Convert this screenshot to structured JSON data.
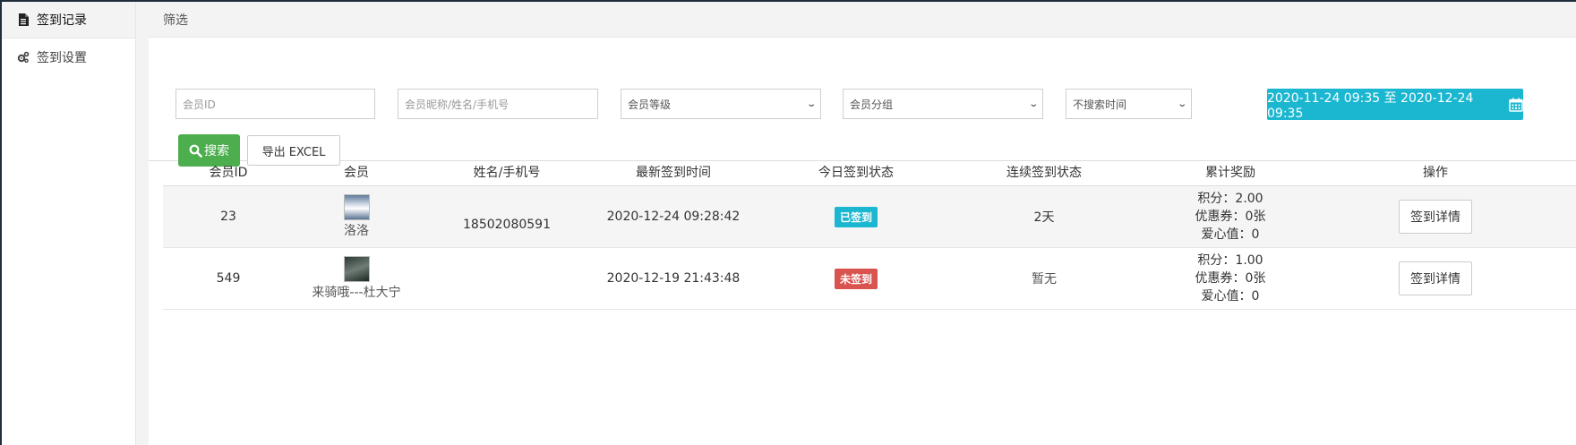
{
  "sidebar": {
    "items": [
      {
        "label": "签到记录",
        "icon": "file-icon",
        "active": true
      },
      {
        "label": "签到设置",
        "icon": "gears-icon",
        "active": false
      }
    ]
  },
  "header": {
    "title": "筛选"
  },
  "filters": {
    "member_id_placeholder": "会员ID",
    "name_placeholder": "会员昵称/姓名/手机号",
    "level_select": "会员等级",
    "group_select": "会员分组",
    "time_select": "不搜索时间",
    "date_range": "2020-11-24 09:35 至 2020-12-24 09:35",
    "search_label": "搜索",
    "export_label": "导出 EXCEL"
  },
  "table": {
    "columns": [
      "会员ID",
      "会员",
      "姓名/手机号",
      "最新签到时间",
      "今日签到状态",
      "连续签到状态",
      "累计奖励",
      "操作"
    ],
    "rows": [
      {
        "id": "23",
        "member": "洛洛",
        "name_phone": "18502080591",
        "last_sign_time": "2020-12-24 09:28:42",
        "today_status": "已签到",
        "streak": "2天",
        "points_label": "积分：",
        "points": "2.00",
        "coupon_label": "优惠券：",
        "coupons": "0张",
        "love_label": "爱心值：",
        "love": "0",
        "action": "签到详情"
      },
      {
        "id": "549",
        "member": "来骑哦---杜大宁",
        "name_phone": "",
        "last_sign_time": "2020-12-19 21:43:48",
        "today_status": "未签到",
        "streak": "暂无",
        "points_label": "积分：",
        "points": "1.00",
        "coupon_label": "优惠券：",
        "coupons": "0张",
        "love_label": "爱心值：",
        "love": "0",
        "action": "签到详情"
      }
    ]
  },
  "colors": {
    "accent": "#1bb7d1",
    "success": "#4cae4c",
    "danger": "#d9534f"
  }
}
